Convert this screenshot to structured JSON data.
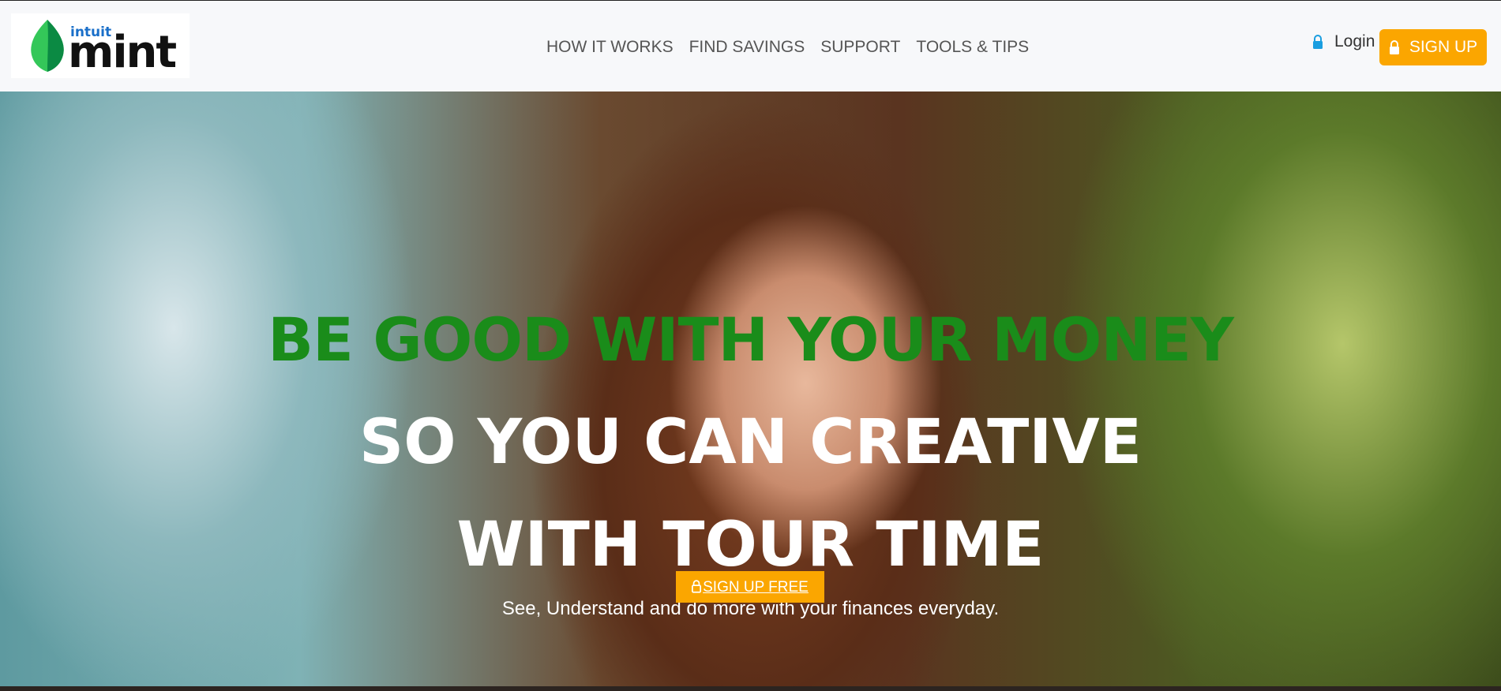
{
  "brand": {
    "intuit": "intuit",
    "name": "mint",
    "leaf_colors": [
      "#1db954",
      "#0a7d3a"
    ]
  },
  "nav": {
    "items": [
      {
        "label": "HOW IT WORKS"
      },
      {
        "label": "FIND SAVINGS"
      },
      {
        "label": "SUPPORT"
      },
      {
        "label": "TOOLS & TIPS"
      }
    ]
  },
  "header": {
    "login_label": "Login",
    "signup_label": "SIGN UP",
    "lock_icon": "lock-icon"
  },
  "hero": {
    "line1": "BE GOOD WITH YOUR MONEY",
    "line2": "SO YOU CAN CREATIVE",
    "line3": "WITH TOUR TIME",
    "subtitle": "See, Understand and do more with your finances everyday.",
    "cta_label": "SIGN UP FREE"
  },
  "colors": {
    "accent": "#fba600",
    "headline_green": "#1a8c1a",
    "login_lock": "#1a9ee0"
  }
}
